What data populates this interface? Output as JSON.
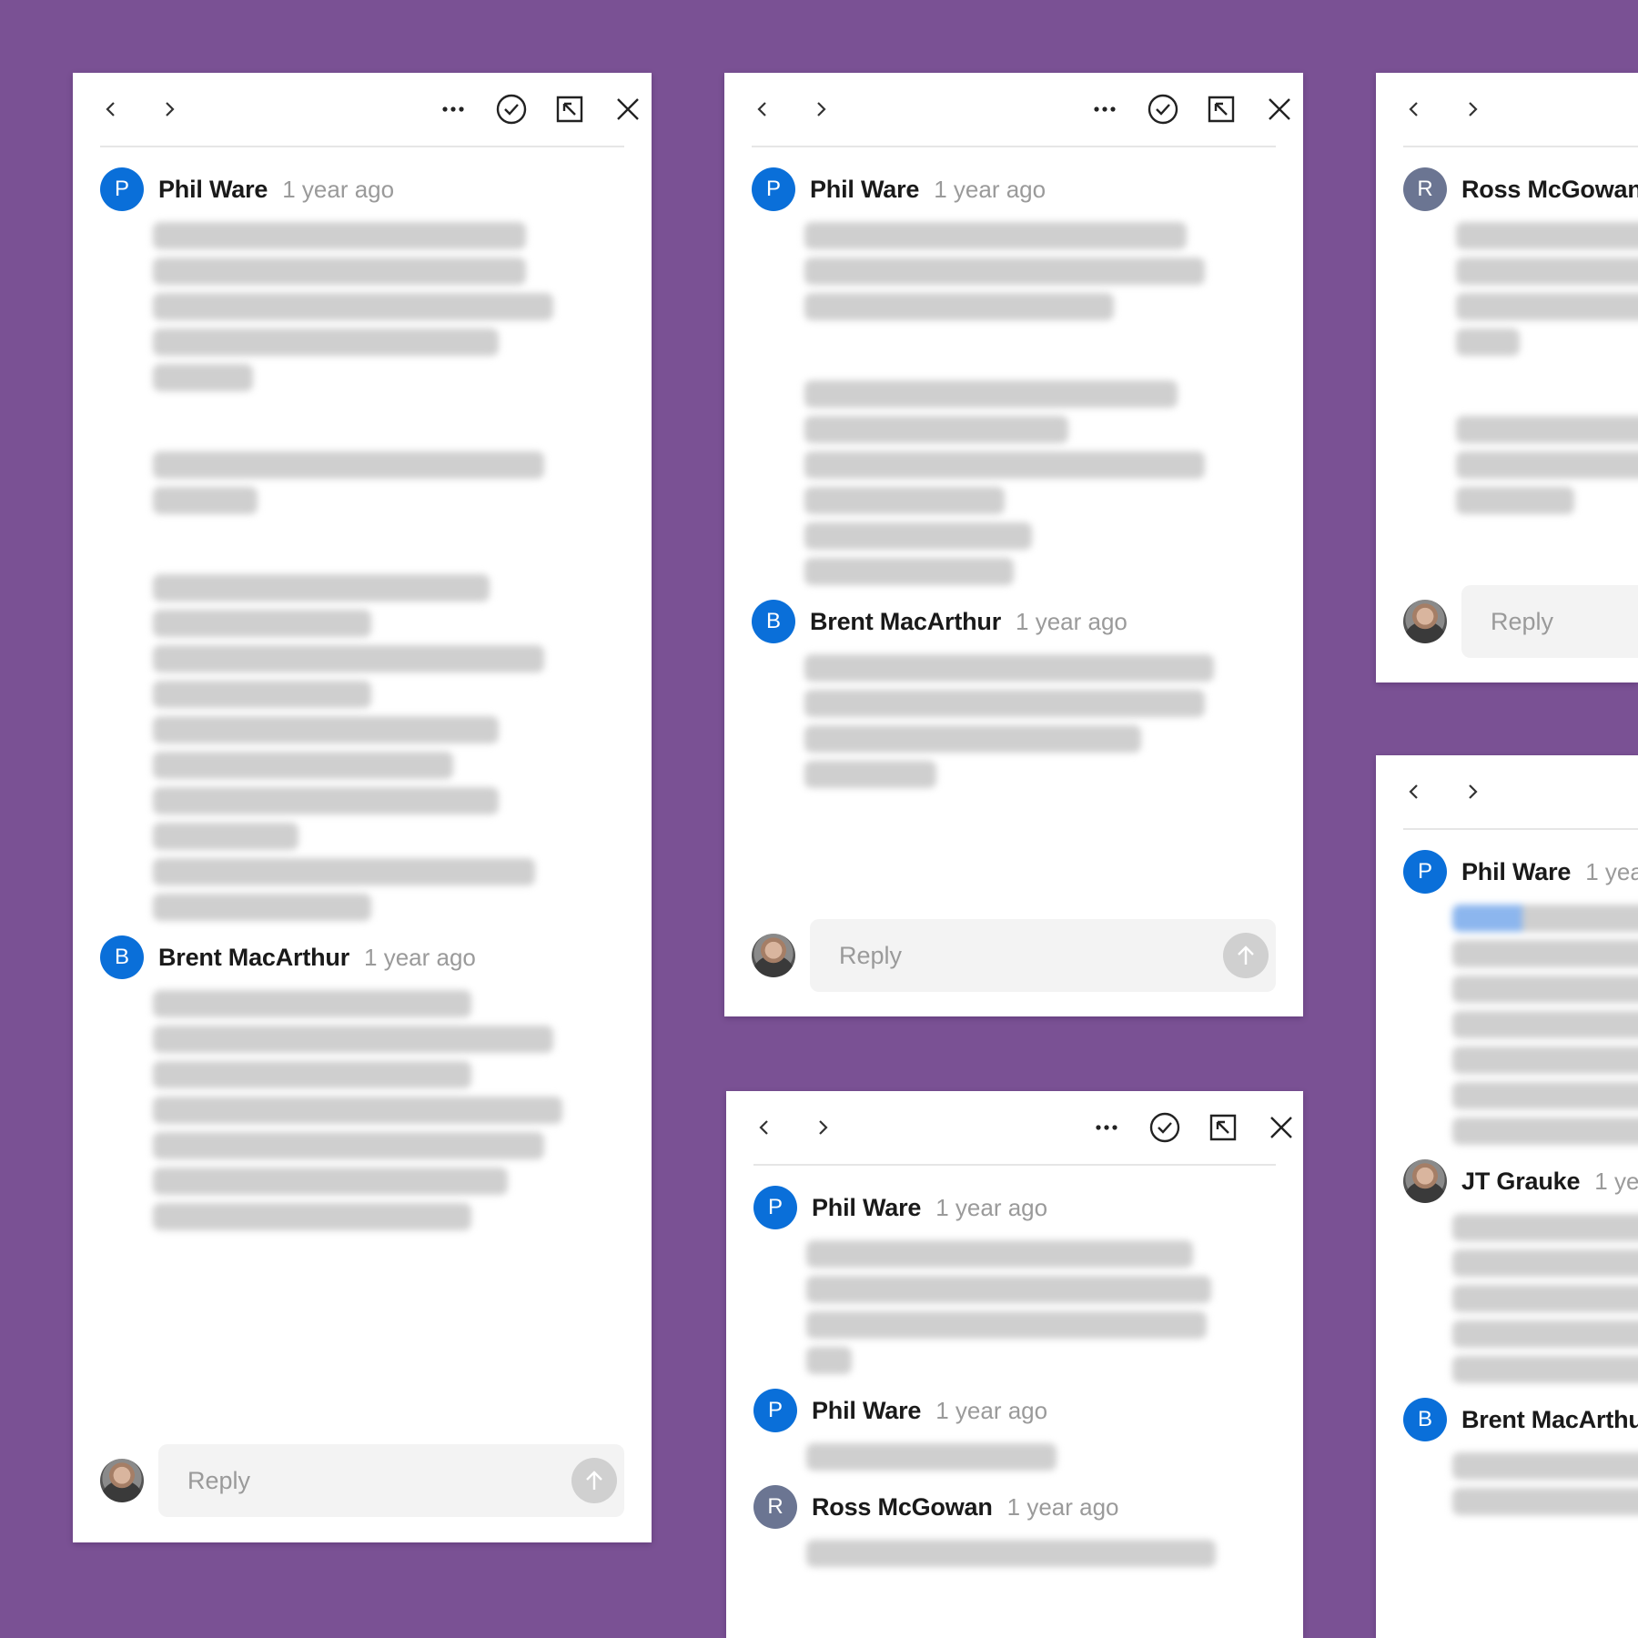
{
  "colors": {
    "background": "#7a5194",
    "avatar_blue": "#0a6fd9",
    "avatar_gray": "#6b7592",
    "muted_text": "#9a9a9a"
  },
  "icons": [
    "chevron-left-icon",
    "chevron-right-icon",
    "more-icon",
    "resolve-check-icon",
    "collapse-arrow-icon",
    "close-icon",
    "send-arrow-icon"
  ],
  "reply_placeholder": "Reply",
  "panels": [
    {
      "comments": [
        {
          "avatar_letter": "P",
          "author": "Phil Ware",
          "time": "1 year ago"
        },
        {
          "avatar_letter": "B",
          "author": "Brent MacArthur",
          "time": "1 year ago"
        }
      ]
    },
    {
      "comments": [
        {
          "avatar_letter": "P",
          "author": "Phil Ware",
          "time": "1 year ago"
        },
        {
          "avatar_letter": "B",
          "author": "Brent MacArthur",
          "time": "1 year ago"
        }
      ]
    },
    {
      "comments": [
        {
          "avatar_letter": "P",
          "author": "Phil Ware",
          "time": "1 year ago"
        },
        {
          "avatar_letter": "P",
          "author": "Phil Ware",
          "time": "1 year ago"
        },
        {
          "avatar_letter": "R",
          "author": "Ross McGowan",
          "time": "1 year ago"
        }
      ]
    },
    {
      "comments": [
        {
          "avatar_letter": "R",
          "author": "Ross McGowan",
          "time": ""
        }
      ]
    },
    {
      "comments": [
        {
          "avatar_letter": "P",
          "author": "Phil Ware",
          "time": "1 yea"
        },
        {
          "avatar_letter": "",
          "author": "JT Grauke",
          "time": "1 ye"
        },
        {
          "avatar_letter": "B",
          "author": "Brent MacArthu",
          "time": ""
        }
      ]
    }
  ]
}
